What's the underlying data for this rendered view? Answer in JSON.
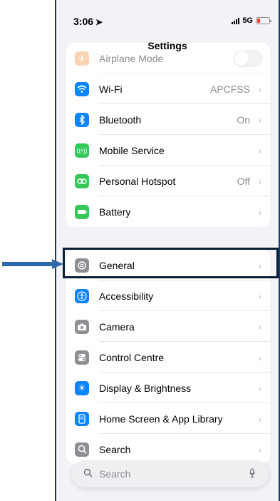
{
  "status_bar": {
    "time": "3:06",
    "network": "5G"
  },
  "title": "Settings",
  "group1": [
    {
      "label": "Airplane Mode",
      "value": "",
      "type": "toggle",
      "icon": "airplane-icon",
      "color": "#f7a05a"
    },
    {
      "label": "Wi-Fi",
      "value": "APCFSS",
      "type": "link",
      "icon": "wifi-icon",
      "color": "#0a84ff"
    },
    {
      "label": "Bluetooth",
      "value": "On",
      "type": "link",
      "icon": "bluetooth-icon",
      "color": "#0a84ff"
    },
    {
      "label": "Mobile Service",
      "value": "",
      "type": "link",
      "icon": "antenna-icon",
      "color": "#34c759"
    },
    {
      "label": "Personal Hotspot",
      "value": "Off",
      "type": "link",
      "icon": "hotspot-icon",
      "color": "#34c759"
    },
    {
      "label": "Battery",
      "value": "",
      "type": "link",
      "icon": "battery-icon",
      "color": "#34c759"
    }
  ],
  "group2": [
    {
      "label": "General",
      "icon": "gear-icon",
      "color": "#8e8e93"
    },
    {
      "label": "Accessibility",
      "icon": "accessibility-icon",
      "color": "#0a84ff"
    },
    {
      "label": "Camera",
      "icon": "camera-icon",
      "color": "#8e8e93"
    },
    {
      "label": "Control Centre",
      "icon": "toggles-icon",
      "color": "#8e8e93"
    },
    {
      "label": "Display & Brightness",
      "icon": "sun-icon",
      "color": "#0a84ff"
    },
    {
      "label": "Home Screen & App Library",
      "icon": "phone-screen-icon",
      "color": "#0a84ff"
    },
    {
      "label": "Search",
      "icon": "search-icon",
      "color": "#8e8e93"
    }
  ],
  "search": {
    "placeholder": "Search"
  },
  "colors": {
    "highlight": "#0b1e33",
    "arrow": "#2f6aa8",
    "frame": "#1c3d68"
  }
}
